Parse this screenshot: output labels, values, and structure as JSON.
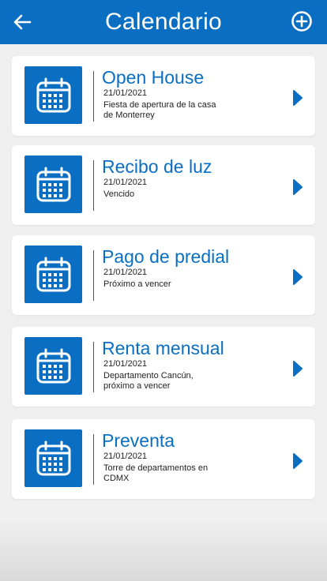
{
  "header": {
    "title": "Calendario",
    "back_icon": "arrow-left-icon",
    "add_icon": "plus-circle-icon"
  },
  "colors": {
    "brand_blue": "#0a6fc2",
    "background": "#efefef",
    "card": "#ffffff"
  },
  "events": [
    {
      "title": "Open House",
      "date": "21/01/2021",
      "description": "Fiesta  de apertura de la casa de Monterrey"
    },
    {
      "title": "Recibo de luz",
      "date": "21/01/2021",
      "description": "Vencido"
    },
    {
      "title": "Pago de predial",
      "date": "21/01/2021",
      "description": "Próximo a vencer"
    },
    {
      "title": "Renta mensual",
      "date": "21/01/2021",
      "description": "Departamento Cancún, próximo a vencer"
    },
    {
      "title": "Preventa",
      "date": "21/01/2021",
      "description": "Torre de departamentos en CDMX"
    }
  ]
}
